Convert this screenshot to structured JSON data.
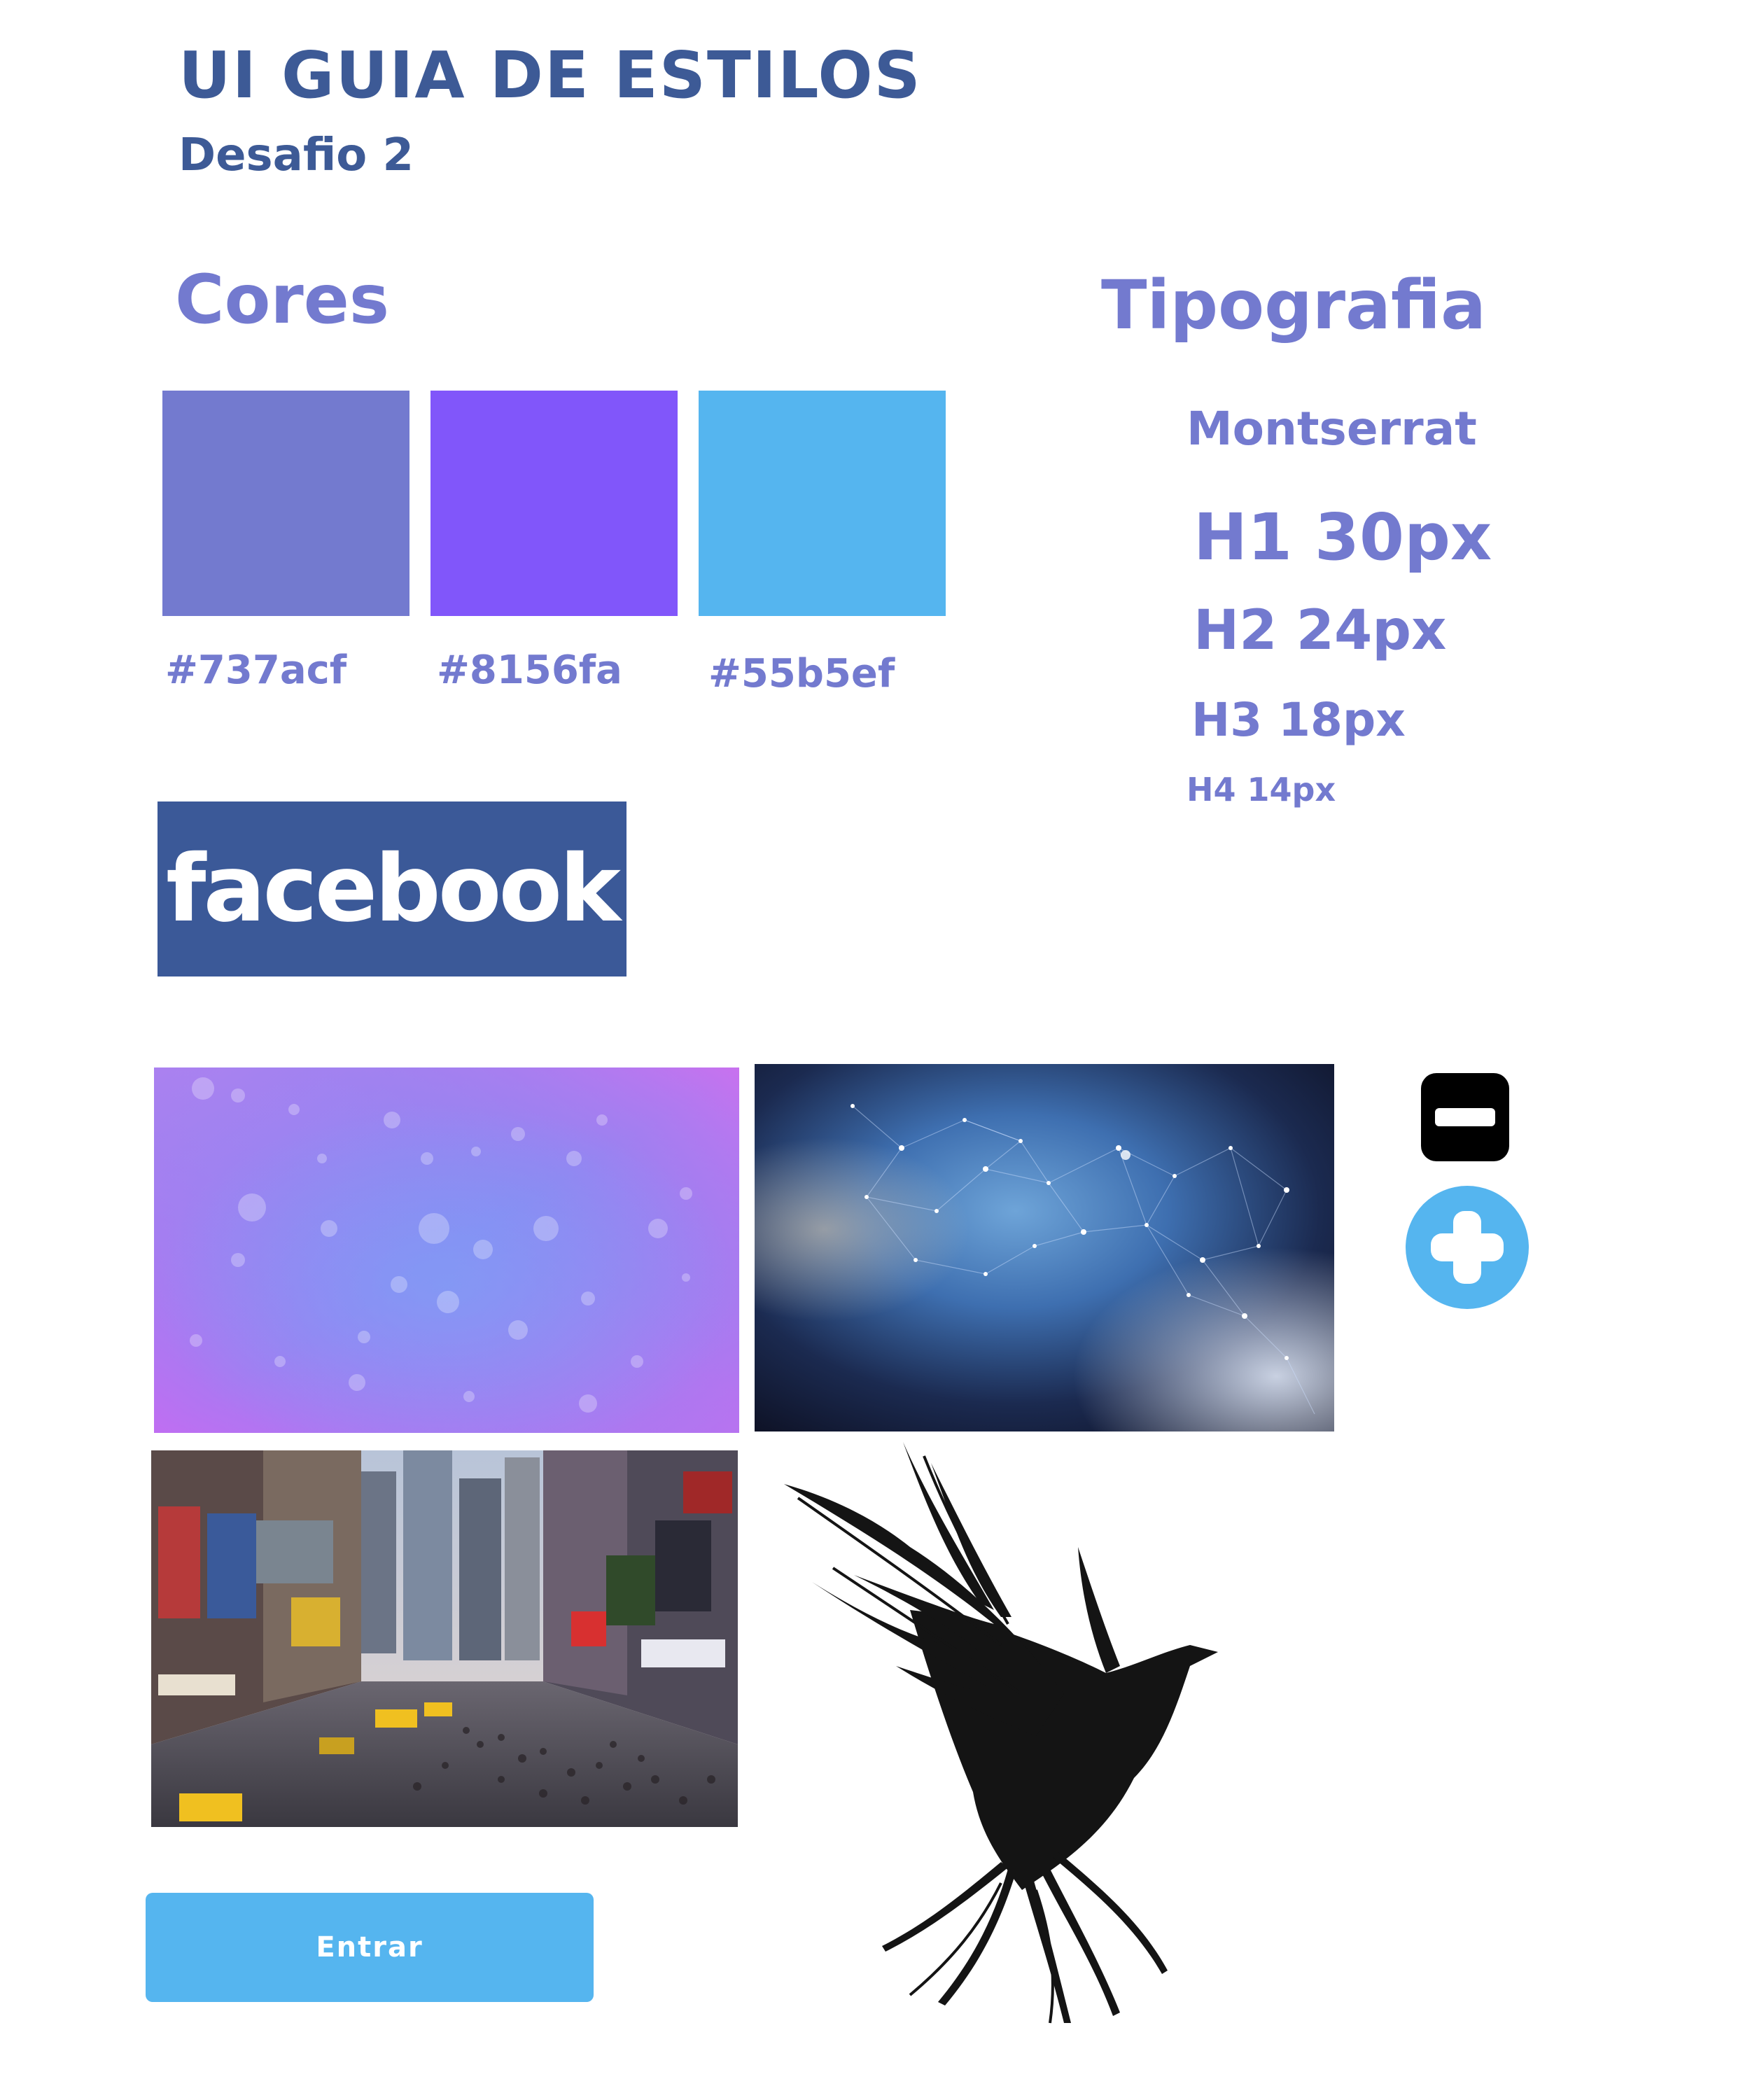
{
  "header": {
    "title": "UI GUIA DE ESTILOS",
    "subtitle": "Desafio 2"
  },
  "colors_section": {
    "heading": "Cores",
    "swatches": [
      {
        "hex_label": "#737acf",
        "color": "#737acf"
      },
      {
        "hex_label": "#8156fa",
        "color": "#8156fa"
      },
      {
        "hex_label": "#55b5ef",
        "color": "#55b5ef"
      }
    ]
  },
  "typography_section": {
    "heading": "Tipografia",
    "font_name": "Montserrat",
    "samples": [
      "H1 30px",
      "H2 24px",
      "H3 18px",
      "H4 14px"
    ]
  },
  "facebook_logo": {
    "text": "facebook",
    "color": "#3b5998"
  },
  "icons": {
    "minus": "minus-icon",
    "plus": "plus-icon",
    "plus_color": "#55b5ef"
  },
  "button": {
    "label": "Entrar",
    "color": "#55b5ef"
  }
}
